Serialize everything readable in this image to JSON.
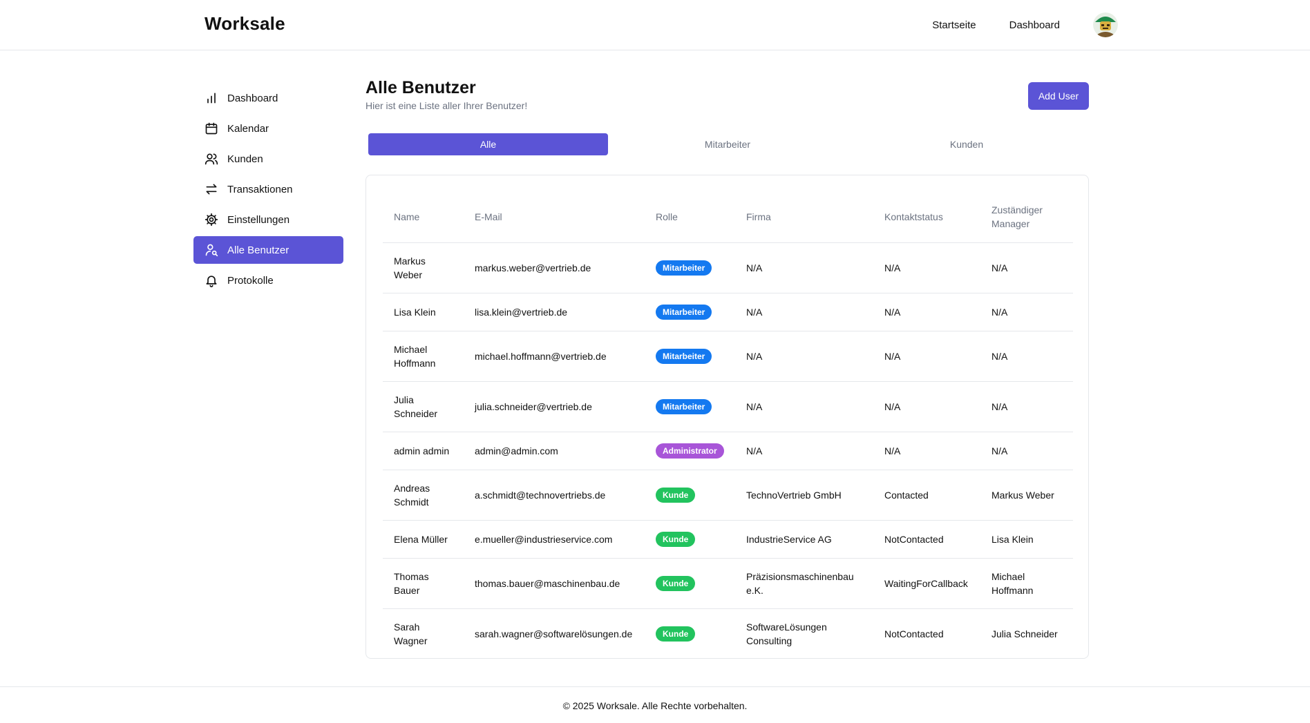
{
  "header": {
    "brand": "Worksale",
    "nav": [
      "Startseite",
      "Dashboard"
    ]
  },
  "sidebar": {
    "items": [
      {
        "label": "Dashboard",
        "icon": "bar-chart-icon"
      },
      {
        "label": "Kalendar",
        "icon": "calendar-icon"
      },
      {
        "label": "Kunden",
        "icon": "users-icon"
      },
      {
        "label": "Transaktionen",
        "icon": "arrows-swap-icon"
      },
      {
        "label": "Einstellungen",
        "icon": "gear-icon"
      },
      {
        "label": "Alle Benutzer",
        "icon": "user-search-icon",
        "active": true
      },
      {
        "label": "Protokolle",
        "icon": "bell-icon"
      }
    ]
  },
  "main": {
    "title": "Alle Benutzer",
    "subtitle": "Hier ist eine Liste aller Ihrer Benutzer!",
    "add_button": "Add User",
    "tabs": [
      "Alle",
      "Mitarbeiter",
      "Kunden"
    ],
    "active_tab": "Alle"
  },
  "table": {
    "headers": [
      "Name",
      "E-Mail",
      "Rolle",
      "Firma",
      "Kontaktstatus",
      "Zuständiger Manager"
    ],
    "rows": [
      {
        "name": "Markus Weber",
        "email": "markus.weber@vertrieb.de",
        "role": "Mitarbeiter",
        "company": "N/A",
        "status": "N/A",
        "manager": "N/A"
      },
      {
        "name": "Lisa Klein",
        "email": "lisa.klein@vertrieb.de",
        "role": "Mitarbeiter",
        "company": "N/A",
        "status": "N/A",
        "manager": "N/A"
      },
      {
        "name": "Michael Hoffmann",
        "email": "michael.hoffmann@vertrieb.de",
        "role": "Mitarbeiter",
        "company": "N/A",
        "status": "N/A",
        "manager": "N/A"
      },
      {
        "name": "Julia Schneider",
        "email": "julia.schneider@vertrieb.de",
        "role": "Mitarbeiter",
        "company": "N/A",
        "status": "N/A",
        "manager": "N/A"
      },
      {
        "name": "admin admin",
        "email": "admin@admin.com",
        "role": "Administrator",
        "company": "N/A",
        "status": "N/A",
        "manager": "N/A"
      },
      {
        "name": "Andreas Schmidt",
        "email": "a.schmidt@technovertriebs.de",
        "role": "Kunde",
        "company": "TechnoVertrieb GmbH",
        "status": "Contacted",
        "manager": "Markus Weber"
      },
      {
        "name": "Elena Müller",
        "email": "e.mueller@industrieservice.com",
        "role": "Kunde",
        "company": "IndustrieService AG",
        "status": "NotContacted",
        "manager": "Lisa Klein"
      },
      {
        "name": "Thomas Bauer",
        "email": "thomas.bauer@maschinenbau.de",
        "role": "Kunde",
        "company": "Präzisionsmaschinenbau e.K.",
        "status": "WaitingForCallback",
        "manager": "Michael Hoffmann"
      },
      {
        "name": "Sarah Wagner",
        "email": "sarah.wagner@softwarelösungen.de",
        "role": "Kunde",
        "company": "SoftwareLösungen Consulting",
        "status": "NotContacted",
        "manager": "Julia Schneider"
      }
    ]
  },
  "role_colors": {
    "Mitarbeiter": "#1479f0",
    "Administrator": "#a855d8",
    "Kunde": "#22c35e"
  },
  "accent_color": "#5b54d6",
  "footer": {
    "text": "© 2025 Worksale. Alle Rechte vorbehalten."
  }
}
